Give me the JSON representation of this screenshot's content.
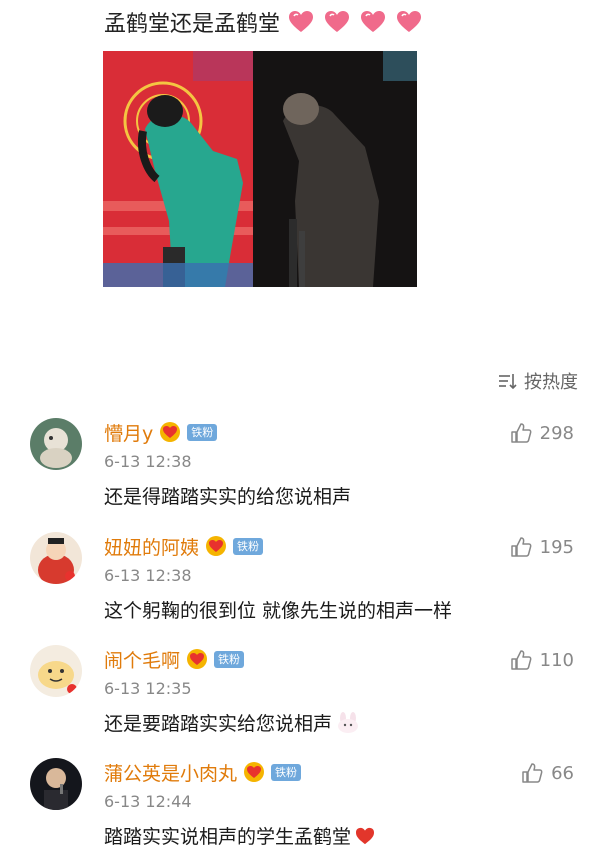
{
  "post": {
    "text": "孟鹤堂还是孟鹤堂"
  },
  "sort": {
    "label": "按热度",
    "icon": "sort-icon"
  },
  "comments": [
    {
      "username": "懵月y",
      "fan_badge": "铁粉",
      "time": "6-13 12:38",
      "text": "还是得踏踏实实的给您说相声",
      "likes": "298"
    },
    {
      "username": "妞妞的阿姨",
      "fan_badge": "铁粉",
      "time": "6-13 12:38",
      "text": "这个躬鞠的很到位 就像先生说的相声一样",
      "likes": "195"
    },
    {
      "username": "闹个毛啊",
      "fan_badge": "铁粉",
      "time": "6-13 12:35",
      "text": "还是要踏踏实实给您说相声",
      "likes": "110"
    },
    {
      "username": "蒲公英是小肉丸",
      "fan_badge": "铁粉",
      "time": "6-13 12:44",
      "text": "踏踏实实说相声的学生孟鹤堂",
      "likes": "66"
    }
  ],
  "colors": {
    "username": "#e07b0b",
    "fan_badge": "#6fa8dc"
  }
}
